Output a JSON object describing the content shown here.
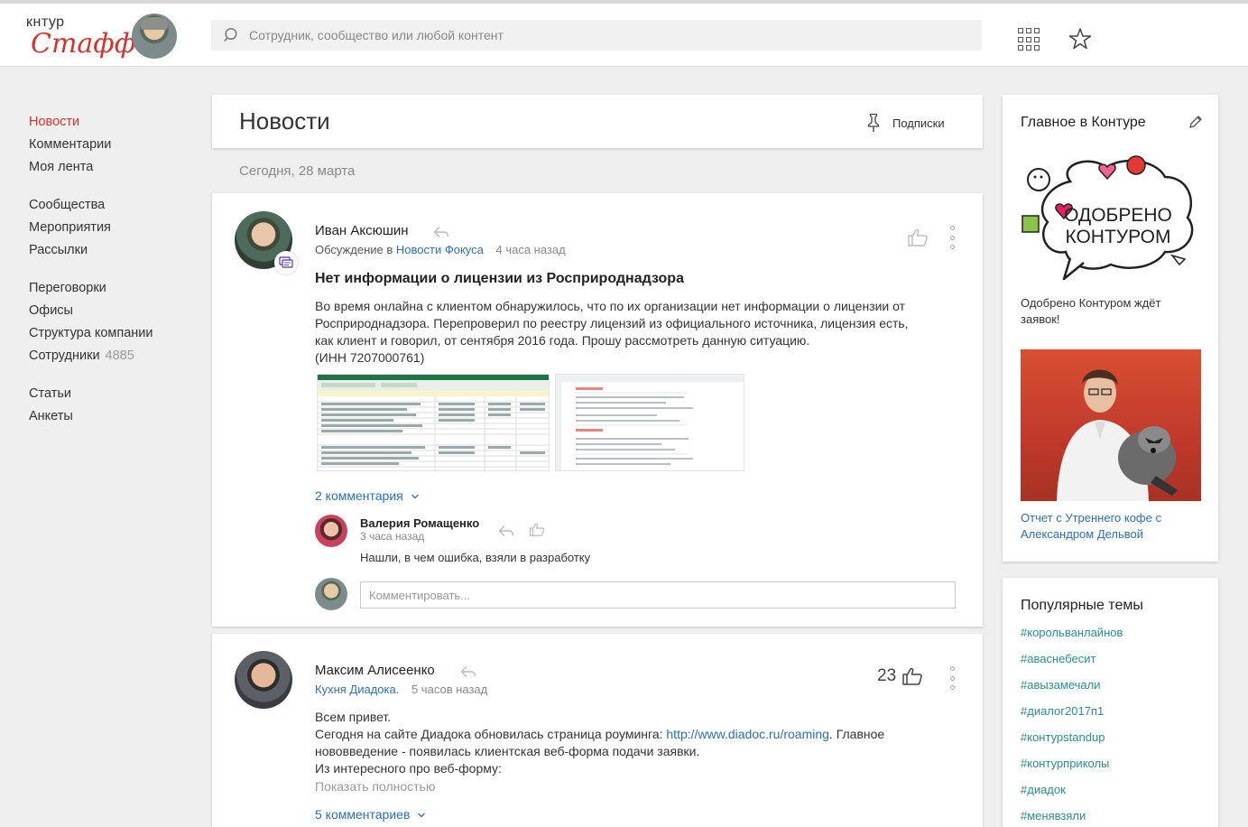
{
  "header": {
    "logo_top": "кнтур",
    "logo_bottom": "Стафф",
    "search_placeholder": "Сотрудник, сообщество или любой контент"
  },
  "leftnav": {
    "groups": [
      [
        {
          "label": "Новости",
          "active": true
        },
        {
          "label": "Комментарии"
        },
        {
          "label": "Моя лента"
        }
      ],
      [
        {
          "label": "Сообщества"
        },
        {
          "label": "Мероприятия"
        },
        {
          "label": "Рассылки"
        }
      ],
      [
        {
          "label": "Переговорки"
        },
        {
          "label": "Офисы"
        },
        {
          "label": "Структура компании"
        },
        {
          "label": "Сотрудники",
          "count": "4885"
        }
      ],
      [
        {
          "label": "Статьи"
        },
        {
          "label": "Анкеты"
        }
      ]
    ]
  },
  "news": {
    "title": "Новости",
    "subscriptions_label": "Подписки",
    "date_label": "Сегодня, 28 марта"
  },
  "post1": {
    "author": "Иван Аксюшин",
    "meta_prefix": "Обсуждение в",
    "meta_link": "Новости Фокуса",
    "time": "4 часа назад",
    "title": "Нет информации о лицензии из Росприроднадзора",
    "body_line1": "Во время онлайна с клиентом обнаружилось, что по их организации нет информации о лицензии от",
    "body_line2": "Росприроднадзора. Перепроверил по реестру лицензий из официального источника, лицензия есть,",
    "body_line3": "как клиент и говорил, от сентября 2016 года. Прошу рассмотреть данную ситуацию.",
    "body_line4": "(ИНН 7207000761)",
    "comments_toggle": "2 комментария",
    "comment": {
      "author": "Валерия Ромащенко",
      "time": "3 часа назад",
      "text": "Нашли, в чем ошибка, взяли в разработку"
    },
    "comment_placeholder": "Комментировать..."
  },
  "post2": {
    "author": "Максим Алисеенко",
    "meta_link": "Кухня Диадока.",
    "time": "5 часов назад",
    "likes": "23",
    "body_line1": "Всем привет.",
    "body_line2_prefix": "Сегодня на сайте Диадока обновилась страница роуминга:",
    "body_link": "http://www.diadoc.ru/roaming",
    "body_line2_suffix": ". Главное",
    "body_line3": "нововведение - появилась клиентская веб-форма подачи заявки.",
    "body_line4": "Из интересного про веб-форму:",
    "show_more": "Показать полностью",
    "comments_toggle": "5 комментариев"
  },
  "sidebar": {
    "highlights_title": "Главное в Контуре",
    "promo_line1": "ОДОБРЕНО",
    "promo_line2": "КОНТУРОМ",
    "promo_caption": "Одобрено Контуром ждёт заявок!",
    "photo_link": "Отчет с Утреннего кофе с Александром Дельвой",
    "popular_title": "Популярные темы",
    "tags": [
      "#корольванлайнов",
      "#аваснебесит",
      "#авызамечали",
      "#диалог2017п1",
      "#контурstandup",
      "#контурприколы",
      "#диадок",
      "#менявзяли"
    ]
  },
  "colors": {
    "accent_red": "#d7332e",
    "link_blue": "#2b6fb6",
    "tag_teal": "#2a8f8a"
  }
}
